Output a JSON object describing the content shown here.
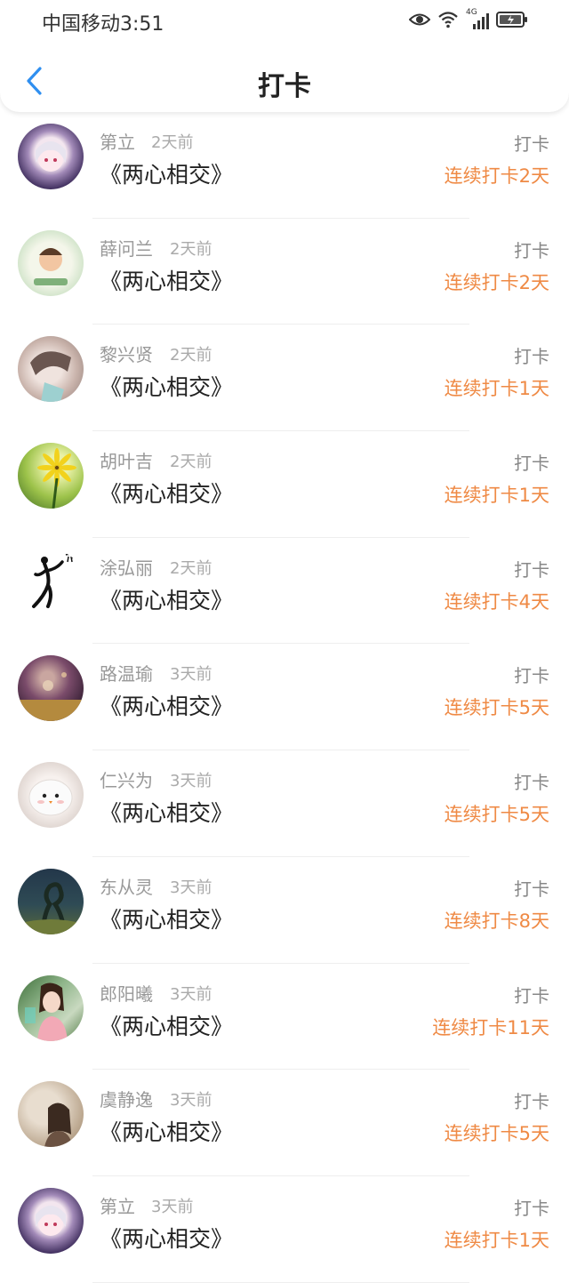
{
  "status_bar": {
    "carrier_time": "中国移动3:51",
    "network": "4G"
  },
  "nav": {
    "title": "打卡",
    "back_icon": "chevron-left-icon"
  },
  "colors": {
    "accent_blue": "#2f8ff0",
    "streak_orange": "#ef8a45"
  },
  "rows": [
    {
      "name": "第立",
      "time": "2天前",
      "book": "《两心相交》",
      "action": "打卡",
      "streak": "连续打卡2天"
    },
    {
      "name": "薛问兰",
      "time": "2天前",
      "book": "《两心相交》",
      "action": "打卡",
      "streak": "连续打卡2天"
    },
    {
      "name": "黎兴贤",
      "time": "2天前",
      "book": "《两心相交》",
      "action": "打卡",
      "streak": "连续打卡1天"
    },
    {
      "name": "胡叶吉",
      "time": "2天前",
      "book": "《两心相交》",
      "action": "打卡",
      "streak": "连续打卡1天"
    },
    {
      "name": "涂弘丽",
      "time": "2天前",
      "book": "《两心相交》",
      "action": "打卡",
      "streak": "连续打卡4天"
    },
    {
      "name": "路温瑜",
      "time": "3天前",
      "book": "《两心相交》",
      "action": "打卡",
      "streak": "连续打卡5天"
    },
    {
      "name": "仁兴为",
      "time": "3天前",
      "book": "《两心相交》",
      "action": "打卡",
      "streak": "连续打卡5天"
    },
    {
      "name": "东从灵",
      "time": "3天前",
      "book": "《两心相交》",
      "action": "打卡",
      "streak": "连续打卡8天"
    },
    {
      "name": "郎阳曦",
      "time": "3天前",
      "book": "《两心相交》",
      "action": "打卡",
      "streak": "连续打卡11天"
    },
    {
      "name": "虞静逸",
      "time": "3天前",
      "book": "《两心相交》",
      "action": "打卡",
      "streak": "连续打卡5天"
    },
    {
      "name": "第立",
      "time": "3天前",
      "book": "《两心相交》",
      "action": "打卡",
      "streak": "连续打卡1天"
    }
  ]
}
